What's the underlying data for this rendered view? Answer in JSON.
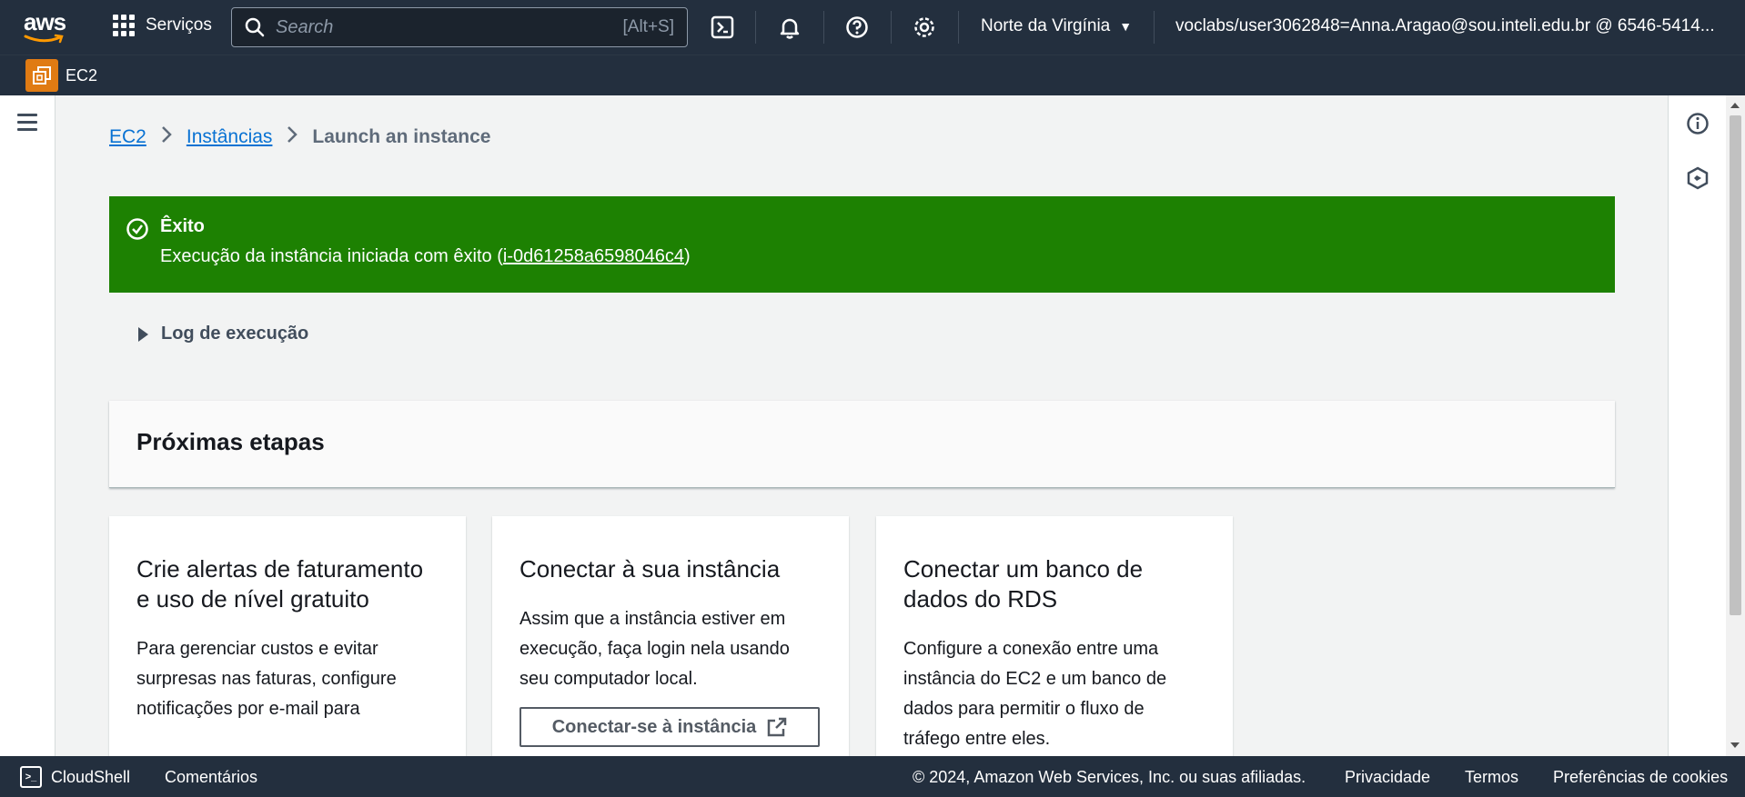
{
  "topnav": {
    "logo_text": "aws",
    "services_label": "Serviços",
    "search_placeholder": "Search",
    "search_shortcut": "[Alt+S]",
    "region": "Norte da Virgínia",
    "account": "voclabs/user3062848=Anna.Aragao@sou.inteli.edu.br @ 6546-5414..."
  },
  "subnav": {
    "service_label": "EC2",
    "badge_color": "#e07b13"
  },
  "breadcrumb": {
    "items": [
      "EC2",
      "Instâncias"
    ],
    "current": "Launch an instance"
  },
  "flash": {
    "title": "Êxito",
    "message_prefix": "Execução da instância iniciada com êxito (",
    "instance_id": "i-0d61258a6598046c4",
    "message_suffix": ")",
    "color": "#1d8102"
  },
  "log": {
    "label": "Log de execução"
  },
  "next_steps": {
    "title": "Próximas etapas",
    "cards": [
      {
        "title": "Crie alertas de faturamento e uso de nível gratuito",
        "body": "Para gerenciar custos e evitar surpresas nas faturas, configure notificações por e-mail para"
      },
      {
        "title": "Conectar à sua instância",
        "body": "Assim que a instância estiver em execução, faça login nela usando seu computador local.",
        "button": "Conectar-se à instância"
      },
      {
        "title": "Conectar um banco de dados do RDS",
        "body": "Configure a conexão entre uma instância do EC2 e um banco de dados para permitir o fluxo de tráfego entre eles."
      }
    ]
  },
  "footer": {
    "cloudshell": "CloudShell",
    "feedback": "Comentários",
    "copyright": "© 2024, Amazon Web Services, Inc. ou suas afiliadas.",
    "privacy": "Privacidade",
    "terms": "Termos",
    "cookies": "Preferências de cookies"
  }
}
